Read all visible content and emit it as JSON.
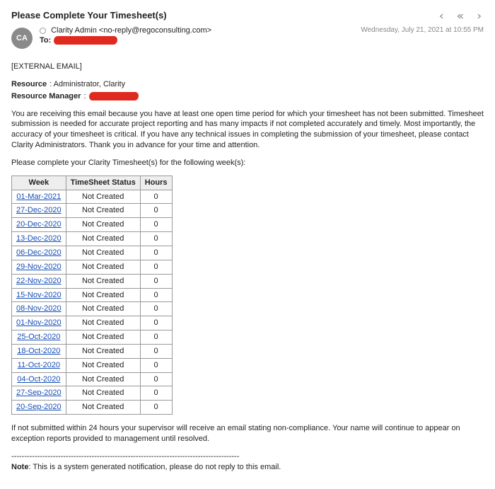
{
  "subject": "Please Complete Your Timesheet(s)",
  "from": {
    "initials": "CA",
    "name": "Clarity Admin",
    "email": "<no-reply@regoconsulting.com>"
  },
  "to_label": "To:",
  "date": "Wednesday, July 21, 2021 at 10:55 PM",
  "external_tag": "[EXTERNAL EMAIL]",
  "resource_label": "Resource",
  "resource_value": ": Administrator, Clarity",
  "resource_manager_label": "Resource Manager",
  "resource_manager_colon": ": ",
  "para1": "You are receiving this email because you have at least one open time period for which your timesheet has not been submitted. Timesheet submission is needed for accurate project reporting and has many impacts if not completed accurately and timely. Most importantly, the accuracy of your timesheet is critical. If you have any technical issues in completing the submission of your timesheet, please contact Clarity Administrators. Thank you in advance for your time and attention.",
  "para2": "Please complete your Clarity Timesheet(s) for the following week(s):",
  "table": {
    "headers": [
      "Week",
      "TimeSheet Status",
      "Hours"
    ],
    "rows": [
      {
        "week": "01-Mar-2021",
        "status": "Not Created",
        "hours": "0"
      },
      {
        "week": "27-Dec-2020",
        "status": "Not Created",
        "hours": "0"
      },
      {
        "week": "20-Dec-2020",
        "status": "Not Created",
        "hours": "0"
      },
      {
        "week": "13-Dec-2020",
        "status": "Not Created",
        "hours": "0"
      },
      {
        "week": "06-Dec-2020",
        "status": "Not Created",
        "hours": "0"
      },
      {
        "week": "29-Nov-2020",
        "status": "Not Created",
        "hours": "0"
      },
      {
        "week": "22-Nov-2020",
        "status": "Not Created",
        "hours": "0"
      },
      {
        "week": "15-Nov-2020",
        "status": "Not Created",
        "hours": "0"
      },
      {
        "week": "08-Nov-2020",
        "status": "Not Created",
        "hours": "0"
      },
      {
        "week": "01-Nov-2020",
        "status": "Not Created",
        "hours": "0"
      },
      {
        "week": "25-Oct-2020",
        "status": "Not Created",
        "hours": "0"
      },
      {
        "week": "18-Oct-2020",
        "status": "Not Created",
        "hours": "0"
      },
      {
        "week": "11-Oct-2020",
        "status": "Not Created",
        "hours": "0"
      },
      {
        "week": "04-Oct-2020",
        "status": "Not Created",
        "hours": "0"
      },
      {
        "week": "27-Sep-2020",
        "status": "Not Created",
        "hours": "0"
      },
      {
        "week": "20-Sep-2020",
        "status": "Not Created",
        "hours": "0"
      }
    ]
  },
  "para3": "If not submitted within 24 hours your supervisor will receive an email stating non-compliance. Your name will continue to appear on exception reports provided to management until resolved.",
  "divider": "----------------------------------------------------------------------------------------",
  "note_label": "Note",
  "note_text": ": This is a system generated notification, please do not reply to this email."
}
